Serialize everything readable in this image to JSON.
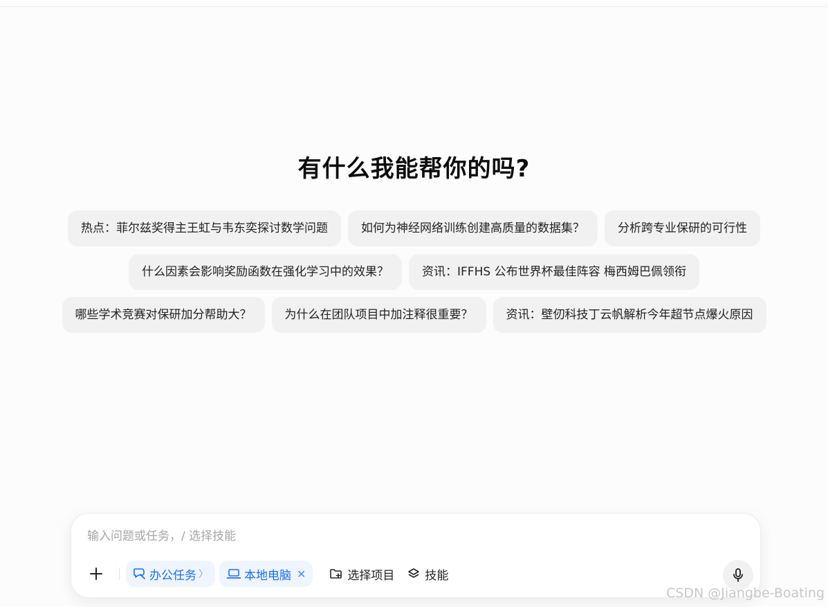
{
  "headline": "有什么我能帮你的吗?",
  "suggestions": {
    "row1": [
      "热点：菲尔兹奖得主王虹与韦东奕探讨数学问题",
      "如何为神经网络训练创建高质量的数据集？",
      "分析跨专业保研的可行性"
    ],
    "row2": [
      "什么因素会影响奖励函数在强化学习中的效果？",
      "资讯：IFFHS 公布世界杯最佳阵容 梅西姆巴佩领衔"
    ],
    "row3": [
      "哪些学术竞赛对保研加分帮助大？",
      "为什么在团队项目中加注释很重要？",
      "资讯：壁仞科技丁云帆解析今年超节点爆火原因"
    ]
  },
  "composer": {
    "placeholder": "输入问题或任务，/ 选择技能",
    "value": "",
    "plus_icon": "plus-icon",
    "office_task": {
      "label": "办公任务",
      "icon": "office-task-icon"
    },
    "local_computer": {
      "label": "本地电脑",
      "icon": "laptop-icon"
    },
    "select_project": {
      "label": "选择项目",
      "icon": "folder-icon"
    },
    "skills": {
      "label": "技能",
      "icon": "layers-icon"
    },
    "mic_icon": "microphone-icon"
  },
  "watermark": "CSDN @Jiangbe-Boating",
  "colors": {
    "accent": "#1a6cf0",
    "pill_bg": "#eef5ff",
    "chip_bg": "#f1f1f1"
  }
}
